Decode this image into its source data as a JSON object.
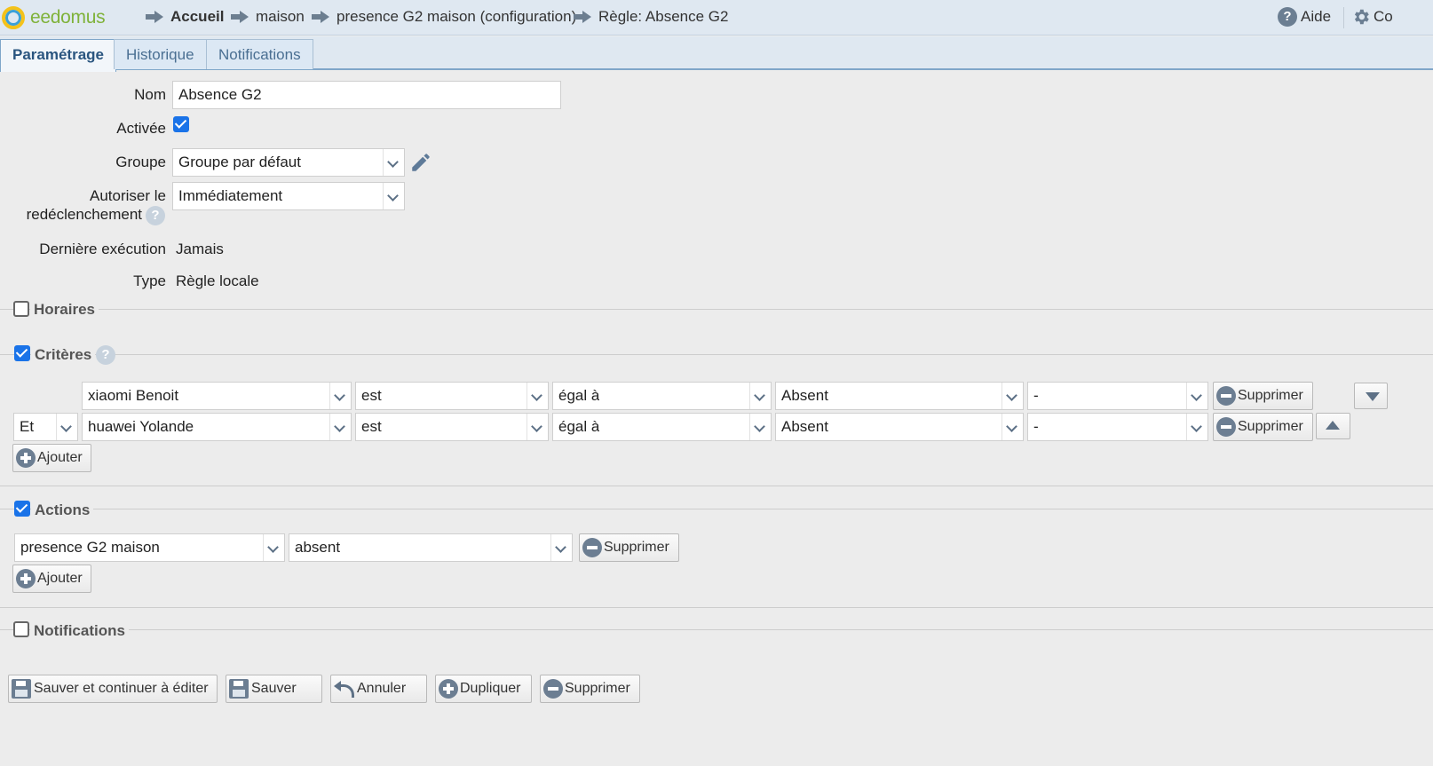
{
  "header": {
    "logo": "eedomus",
    "breadcrumb": [
      "Accueil",
      "maison",
      "presence G2 maison (configuration)",
      "Règle: Absence G2"
    ],
    "help_label": "Aide",
    "config_label": "Co"
  },
  "tabs": [
    "Paramétrage",
    "Historique",
    "Notifications"
  ],
  "form": {
    "name_label": "Nom",
    "name_value": "Absence G2",
    "active_label": "Activée",
    "group_label": "Groupe",
    "group_value": "Groupe par défaut",
    "retrigger_label_1": "Autoriser le",
    "retrigger_label_2": "redéclenchement",
    "retrigger_value": "Immédiatement",
    "last_exec_label": "Dernière exécution",
    "last_exec_value": "Jamais",
    "type_label": "Type",
    "type_value": "Règle locale"
  },
  "sections": {
    "horaires": "Horaires",
    "criteres": "Critères",
    "actions": "Actions",
    "notifications": "Notifications"
  },
  "criteria": [
    {
      "connector": "",
      "device": "xiaomi Benoit",
      "verb": "est",
      "operator": "égal à",
      "value": "Absent",
      "extra": "-",
      "delete_label": "Supprimer"
    },
    {
      "connector": "Et",
      "device": "huawei Yolande",
      "verb": "est",
      "operator": "égal à",
      "value": "Absent",
      "extra": "-",
      "delete_label": "Supprimer"
    }
  ],
  "criteria_add_label": "Ajouter",
  "actions": [
    {
      "device": "presence G2 maison",
      "value": "absent",
      "delete_label": "Supprimer"
    }
  ],
  "actions_add_label": "Ajouter",
  "footer_buttons": {
    "save_continue": "Sauver et continuer à éditer",
    "save": "Sauver",
    "cancel": "Annuler",
    "duplicate": "Dupliquer",
    "delete": "Supprimer"
  },
  "colors": {
    "accent": "#1a73e8",
    "header_bg": "#dfe8f1",
    "icon": "#6c7e92"
  }
}
